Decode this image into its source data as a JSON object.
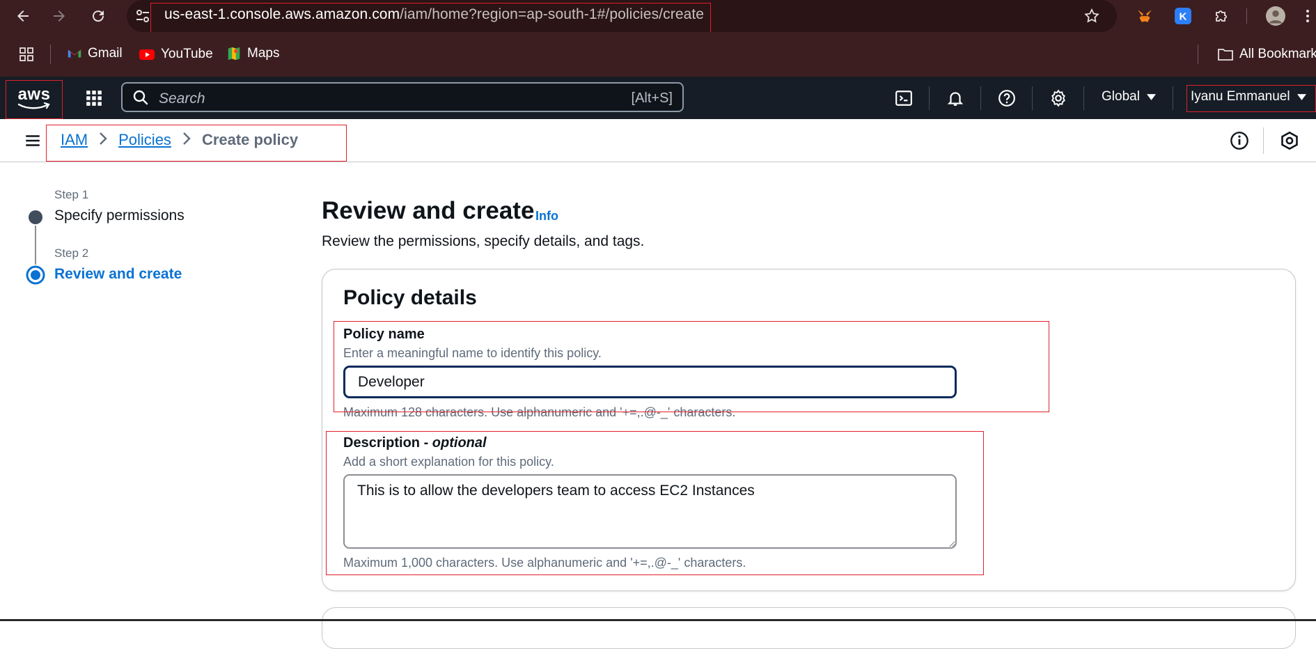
{
  "browser": {
    "url_host": "us-east-1.console.aws.amazon.com",
    "url_path": "/iam/home?region=ap-south-1#/policies/create",
    "bookmarks": [
      {
        "label": "Gmail"
      },
      {
        "label": "YouTube"
      },
      {
        "label": "Maps"
      }
    ],
    "all_bookmarks_label": "All Bookmarks"
  },
  "aws_nav": {
    "logo_text": "aws",
    "search_placeholder": "Search",
    "search_shortcut": "[Alt+S]",
    "region_label": "Global",
    "account_label": "Iyanu Emmanuel"
  },
  "breadcrumb": {
    "items": [
      {
        "label": "IAM"
      },
      {
        "label": "Policies"
      }
    ],
    "current": "Create policy"
  },
  "steps": [
    {
      "step_label": "Step 1",
      "title": "Specify permissions",
      "state": "complete"
    },
    {
      "step_label": "Step 2",
      "title": "Review and create",
      "state": "active"
    }
  ],
  "main": {
    "title": "Review and create",
    "info_label": "Info",
    "description": "Review the permissions, specify details, and tags.",
    "panel": {
      "title": "Policy details",
      "policy_name": {
        "label": "Policy name",
        "description": "Enter a meaningful name to identify this policy.",
        "value": "Developer",
        "constraint": "Maximum 128 characters. Use alphanumeric and '+=,.@-_' characters."
      },
      "description_field": {
        "label": "Description - ",
        "label_optional": "optional",
        "description": "Add a short explanation for this policy.",
        "value": "This is to allow the developers team to access EC2 Instances",
        "constraint": "Maximum 1,000 characters. Use alphanumeric and '+=,.@-_' characters."
      }
    }
  },
  "colors": {
    "chrome_bg": "#3c1e21",
    "aws_nav_bg": "#161d26",
    "link_blue": "#0972d3",
    "annotation_red": "#e0202a"
  }
}
